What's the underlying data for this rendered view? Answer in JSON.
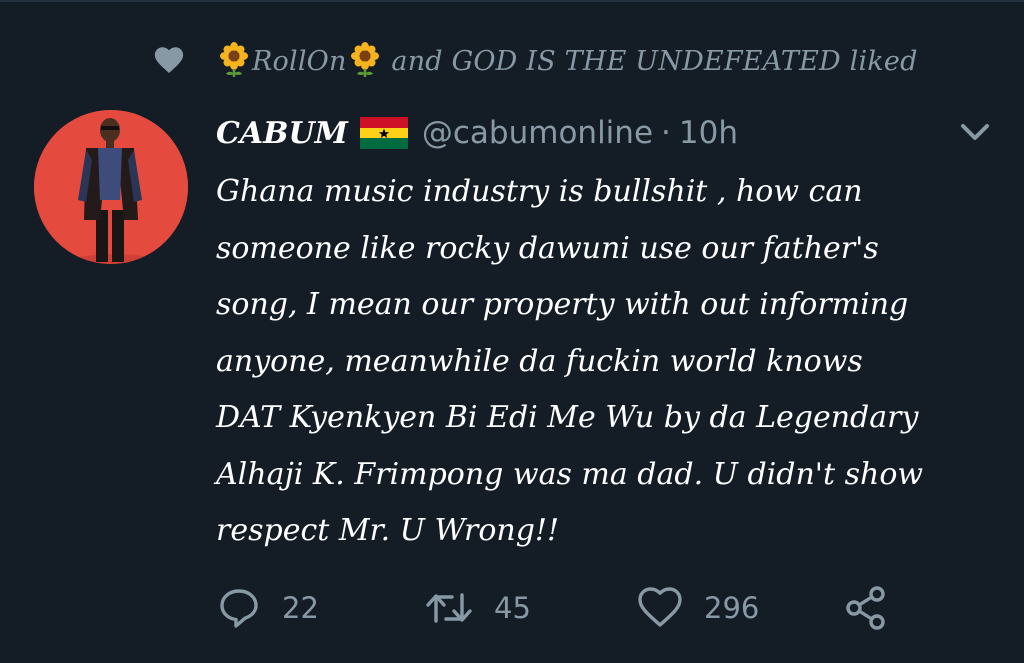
{
  "social_context": {
    "user1": "RollOn",
    "connector": "and",
    "user2": "GOD IS THE UNDEFEATED",
    "suffix": "liked"
  },
  "tweet": {
    "display_name": "CABUM",
    "handle": "@cabumonline",
    "separator": "·",
    "time": "10h",
    "lines": [
      "Ghana music industry is bullshit , how can",
      "someone like rocky dawuni use our father's",
      "song, I mean our property with out informing",
      "anyone, meanwhile da fuckin world knows",
      "DAT Kyenkyen Bi Edi Me Wu by da Legendary",
      "Alhaji K. Frimpong was ma dad. U didn't show",
      "respect Mr. U Wrong!!"
    ]
  },
  "actions": {
    "reply_count": "22",
    "retweet_count": "45",
    "like_count": "296"
  },
  "icons": {
    "liked_indicator": "heart-icon",
    "emoji": "sunflower-icon",
    "flag": "ghana-flag-icon",
    "menu": "chevron-down-icon",
    "reply": "reply-icon",
    "retweet": "retweet-icon",
    "like": "heart-icon",
    "share": "share-icon"
  },
  "colors": {
    "background": "#141d26",
    "secondary_text": "#8899a6",
    "primary_text": "#ffffff",
    "avatar_bg": "#e54a3f"
  }
}
